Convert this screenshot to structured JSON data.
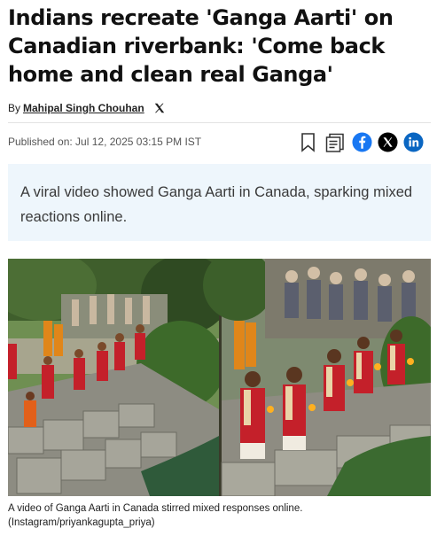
{
  "article": {
    "headline": "Indians recreate 'Ganga Aarti' on Canadian riverbank: 'Come back home and clean real Ganga'",
    "by_prefix": "By",
    "author": "Mahipal Singh Chouhan",
    "published": "Published on: Jul 12, 2025 03:15 PM IST",
    "summary": "A viral video showed Ganga Aarti in Canada, sparking mixed reactions online.",
    "caption": "A video of Ganga Aarti in Canada stirred mixed responses online. (Instagram/priyankagupta_priya)"
  },
  "share": {
    "icons": [
      "bookmark-icon",
      "google-news-icon",
      "facebook-icon",
      "x-icon",
      "linkedin-icon"
    ],
    "colors": {
      "facebook": "#1877f2",
      "x": "#000000",
      "linkedin": "#0a66c2"
    }
  },
  "theme": {
    "summary_bg": "#eef6fc",
    "headline_color": "#111111"
  }
}
